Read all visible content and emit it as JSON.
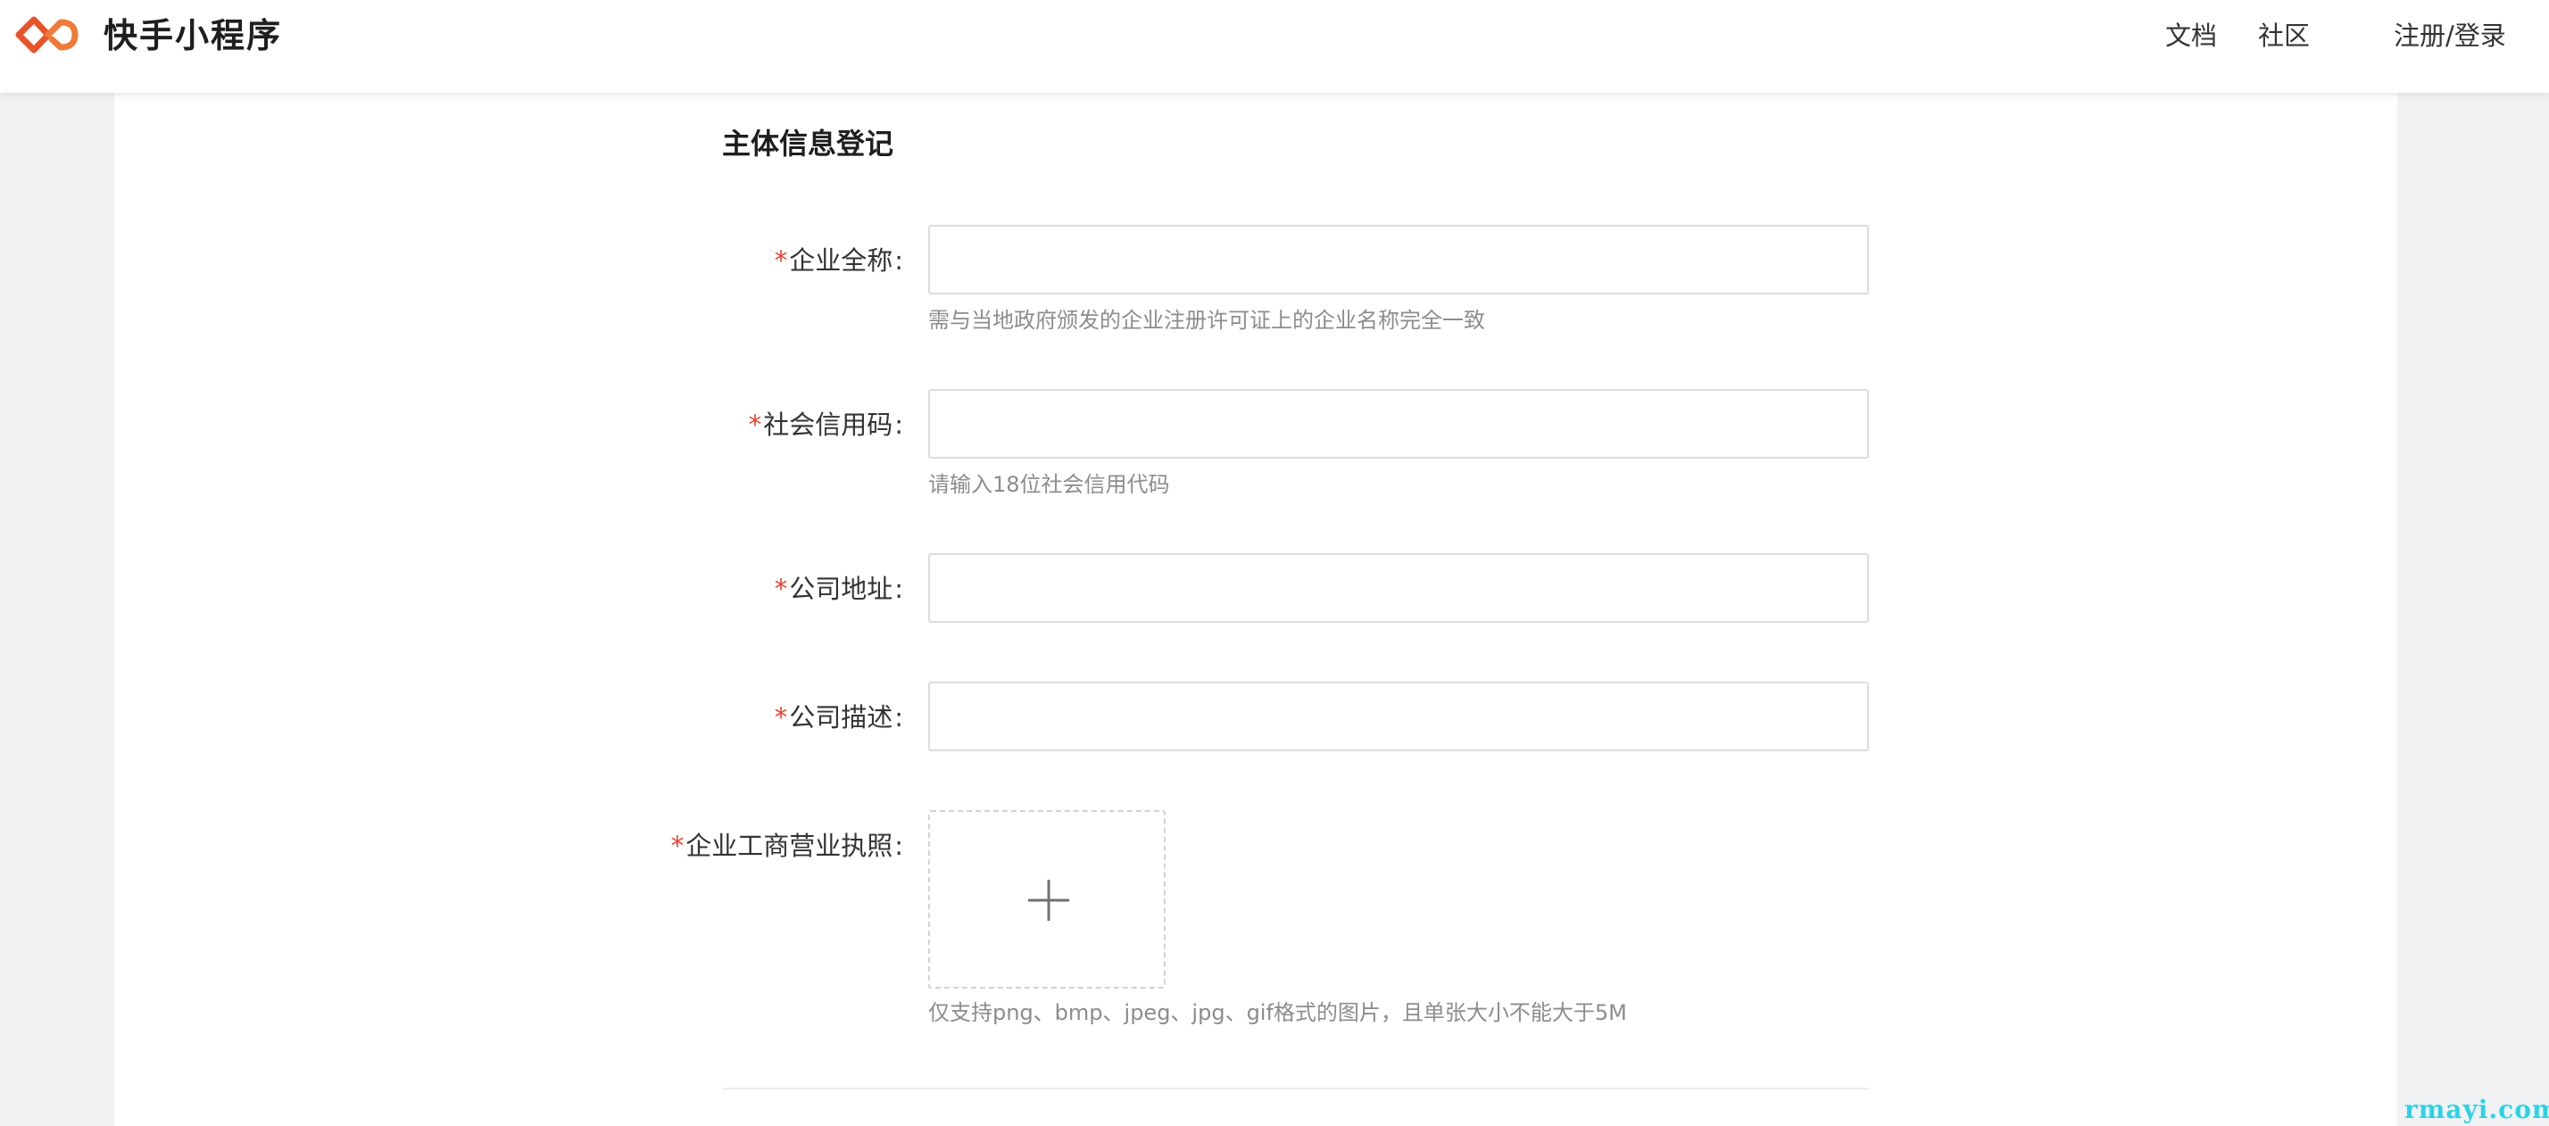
{
  "header": {
    "brand": "快手小程序",
    "nav": {
      "docs": "文档",
      "community": "社区",
      "login": "注册/登录"
    },
    "logo_icon": "kuaishou-mini-program-logo",
    "accent_color": "#e8542a"
  },
  "form": {
    "title": "主体信息登记",
    "required_mark": "*",
    "colon": ":",
    "fields": [
      {
        "label": "企业全称",
        "value": "",
        "hint": "需与当地政府颁发的企业注册许可证上的企业名称完全一致"
      },
      {
        "label": "社会信用码",
        "value": "",
        "hint": "请输入18位社会信用代码"
      },
      {
        "label": "公司地址",
        "value": ""
      },
      {
        "label": "公司描述",
        "value": ""
      }
    ],
    "upload": {
      "label": "企业工商营业执照",
      "icon": "plus-icon",
      "hint": "仅支持png、bmp、jpeg、jpg、gif格式的图片，且单张大小不能大于5M"
    }
  },
  "watermark": "rmayi.com",
  "colors": {
    "required": "#e8402e",
    "hint": "#8c8c8c",
    "page_bg": "#f1f2f4",
    "watermark": "#2ad3e6"
  }
}
